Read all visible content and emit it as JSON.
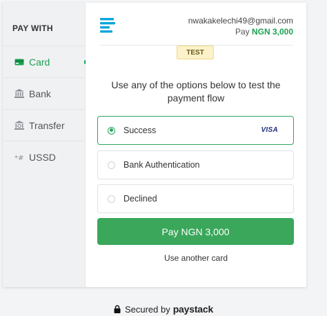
{
  "sidebar": {
    "title": "PAY WITH",
    "items": [
      {
        "label": "Card",
        "icon": "card-icon",
        "active": true
      },
      {
        "label": "Bank",
        "icon": "bank-icon",
        "active": false
      },
      {
        "label": "Transfer",
        "icon": "transfer-icon",
        "active": false
      },
      {
        "label": "USSD",
        "icon": "ussd-icon",
        "active": false
      }
    ]
  },
  "header": {
    "email": "nwakakelechi49@gmail.com",
    "pay_prefix": "Pay",
    "amount": "NGN 3,000",
    "logo_icon": "paystack-logo-icon"
  },
  "badge": "TEST",
  "instructions": "Use any of the options below to test the payment flow",
  "options": [
    {
      "label": "Success",
      "selected": true,
      "brand": "VISA"
    },
    {
      "label": "Bank Authentication",
      "selected": false
    },
    {
      "label": "Declined",
      "selected": false
    }
  ],
  "pay_button": "Pay NGN 3,000",
  "another_card": "Use another card",
  "footer": {
    "secured_by": "Secured by",
    "brand": "paystack"
  },
  "colors": {
    "accent": "#1aa251",
    "button": "#3aa75b",
    "logo": "#0ba4db"
  }
}
